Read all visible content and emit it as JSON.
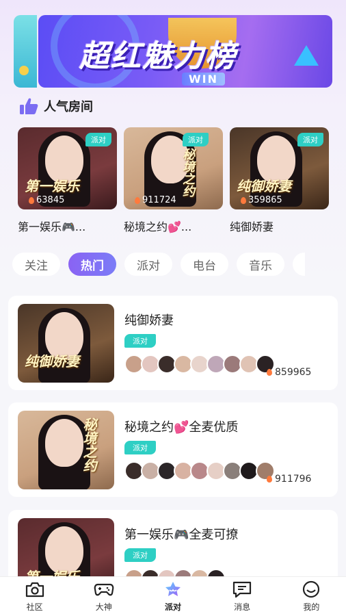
{
  "banner": {
    "title": "超红魅力榜",
    "subtitle": "WIN"
  },
  "popular": {
    "title": "人气房间",
    "cards": [
      {
        "name": "第一娱乐🎮...",
        "tag": "派对",
        "heat": "63845",
        "overlay": "第一娱乐",
        "bg": "#7a3b3e"
      },
      {
        "name": "秘境之约💕...",
        "tag": "派对",
        "heat": "911724",
        "overlay": "秘境之约",
        "bg": "#c9a07e"
      },
      {
        "name": "纯御娇妻",
        "tag": "派对",
        "heat": "359865",
        "overlay": "纯御娇妻",
        "bg": "#7d5a3c"
      }
    ]
  },
  "tabs": [
    "关注",
    "热门",
    "派对",
    "电台",
    "音乐"
  ],
  "active_tab": "热门",
  "rooms": [
    {
      "name": "纯御娇妻",
      "tag": "派对",
      "heat": "859965",
      "overlay": "纯御娇妻",
      "bg": "#7d5a3c"
    },
    {
      "name": "秘境之约💕全麦优质",
      "tag": "派对",
      "heat": "911796",
      "overlay": "秘境之约",
      "bg": "#c9a07e"
    },
    {
      "name": "第一娱乐🎮全麦可撩",
      "tag": "派对",
      "heat": "",
      "overlay": "第一娱乐",
      "bg": "#7a3b3e"
    }
  ],
  "nav": [
    {
      "label": "社区",
      "icon": "camera-icon"
    },
    {
      "label": "大神",
      "icon": "gamepad-icon"
    },
    {
      "label": "派对",
      "icon": "party-icon"
    },
    {
      "label": "消息",
      "icon": "message-icon"
    },
    {
      "label": "我的",
      "icon": "smile-icon"
    }
  ],
  "colors": {
    "accent": "#8a63f3",
    "tag": "#2ecfc4",
    "flame": "#ff7a3d"
  }
}
